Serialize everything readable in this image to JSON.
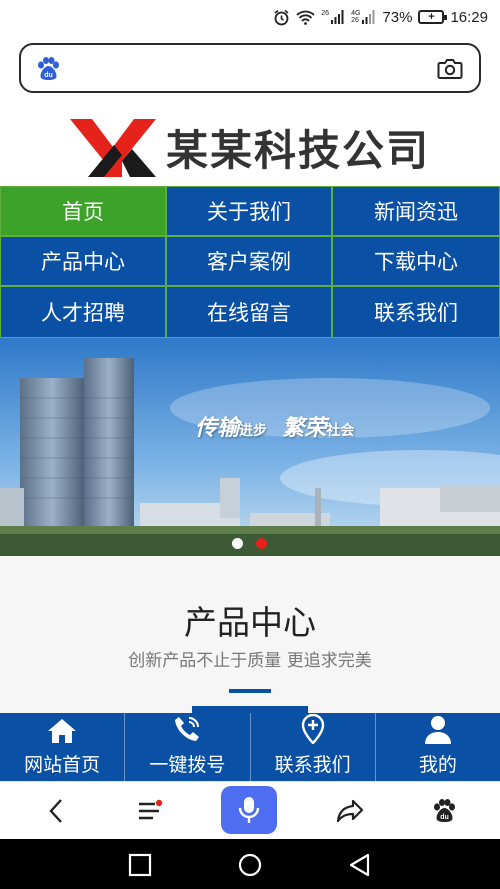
{
  "status_bar": {
    "network_top": "26",
    "network_2_top": "4G",
    "network_2_bottom": "26",
    "battery_percent": "73%",
    "battery_glyph": "+",
    "time": "16:29"
  },
  "search": {
    "value": "",
    "placeholder": ""
  },
  "header": {
    "logo_letters": "YX",
    "company_name": "某某科技公司",
    "brand_red": "#e5231b"
  },
  "nav": {
    "items": [
      {
        "label": "首页",
        "active": true
      },
      {
        "label": "关于我们"
      },
      {
        "label": "新闻资迅"
      },
      {
        "label": "产品中心"
      },
      {
        "label": "客户案例"
      },
      {
        "label": "下载中心"
      },
      {
        "label": "人才招聘"
      },
      {
        "label": "在线留言"
      },
      {
        "label": "联系我们"
      }
    ],
    "colors": {
      "bg": "#0a50a4",
      "active": "#3ca22a",
      "border": "#5fae3a"
    }
  },
  "banner": {
    "slogan_1": "传输",
    "slogan_1_small": "进步",
    "slogan_2": "繁荣",
    "slogan_2_small": "社会",
    "active_slide": 2,
    "slide_count": 2
  },
  "section": {
    "title": "产品中心",
    "subtitle": "创新产品不止于质量 更追求完美"
  },
  "site_nav": {
    "items": [
      {
        "label": "网站首页",
        "icon": "home-icon"
      },
      {
        "label": "一键拨号",
        "icon": "phone-icon"
      },
      {
        "label": "联系我们",
        "icon": "location-pin-icon"
      },
      {
        "label": "我的",
        "icon": "user-icon"
      }
    ]
  },
  "browser_toolbar": {
    "icons": [
      "back-icon",
      "menu-icon",
      "mic-icon",
      "share-icon",
      "baidu-icon"
    ],
    "accent": "#4e6ef2"
  },
  "android_nav": {
    "icons": [
      "recents-icon",
      "home-circle-icon",
      "back-triangle-icon"
    ]
  }
}
